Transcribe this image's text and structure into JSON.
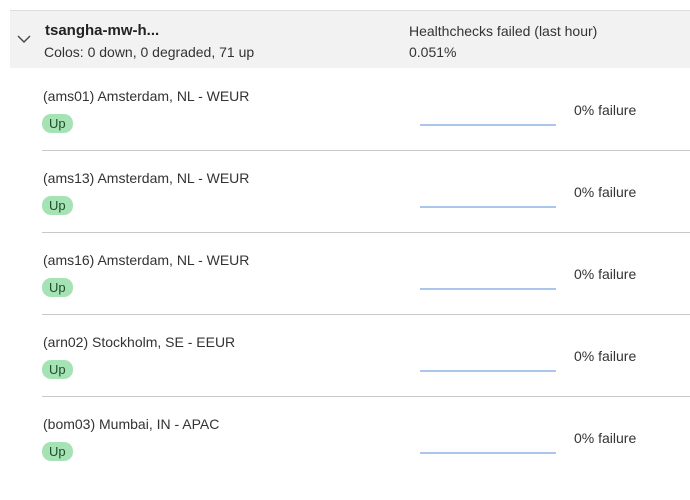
{
  "group": {
    "name": "tsangha-mw-h...",
    "colos_summary": "Colos: 0 down, 0 degraded, 71 up",
    "healthchecks_label": "Healthchecks failed (last hour)",
    "healthchecks_value": "0.051%",
    "chevron_icon": "chevron-down-icon"
  },
  "colos": [
    {
      "name": "(ams01) Amsterdam, NL - WEUR",
      "status": "Up",
      "failure": "0% failure",
      "failure_rate": 0
    },
    {
      "name": "(ams13) Amsterdam, NL - WEUR",
      "status": "Up",
      "failure": "0% failure",
      "failure_rate": 0
    },
    {
      "name": "(ams16) Amsterdam, NL - WEUR",
      "status": "Up",
      "failure": "0% failure",
      "failure_rate": 0
    },
    {
      "name": "(arn02) Stockholm, SE - EEUR",
      "status": "Up",
      "failure": "0% failure",
      "failure_rate": 0
    },
    {
      "name": "(bom03) Mumbai, IN - APAC",
      "status": "Up",
      "failure": "0% failure",
      "failure_rate": 0
    }
  ],
  "colors": {
    "status_up_bg": "#a6e3b4",
    "status_up_text": "#1f4d2a",
    "sparkline": "#8fb4e6"
  }
}
